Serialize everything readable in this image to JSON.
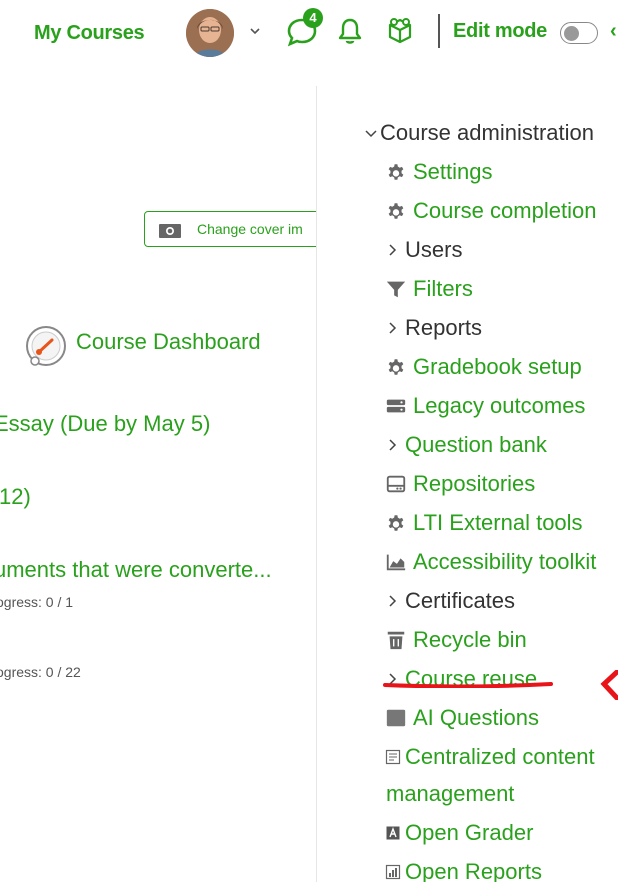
{
  "navbar": {
    "title": "My Courses",
    "messages_count": "4",
    "edit_mode_label": "Edit mode",
    "cut_glyph": "‹"
  },
  "left": {
    "cover_button": "Change cover im",
    "dashboard_link": "Course Dashboard",
    "activities": [
      "Essay (Due by May 5)",
      "12)",
      "uments that were converte..."
    ],
    "progress": [
      "ogress: 0 / 1",
      "ogress: 0 / 22"
    ]
  },
  "admin": {
    "heading": "Course administration",
    "items": [
      {
        "label": "Settings",
        "icon": "gear-icon",
        "kind": "link"
      },
      {
        "label": "Course completion",
        "icon": "gear-icon",
        "kind": "link"
      },
      {
        "label": "Users",
        "icon": "chevron-right-icon",
        "kind": "plain"
      },
      {
        "label": "Filters",
        "icon": "filter-icon",
        "kind": "link"
      },
      {
        "label": "Reports",
        "icon": "chevron-right-icon",
        "kind": "plain"
      },
      {
        "label": "Gradebook setup",
        "icon": "gear-icon",
        "kind": "link"
      },
      {
        "label": "Legacy outcomes",
        "icon": "server-icon",
        "kind": "link"
      },
      {
        "label": "Question bank",
        "icon": "chevron-right-icon",
        "kind": "link"
      },
      {
        "label": "Repositories",
        "icon": "hdd-icon",
        "kind": "link"
      },
      {
        "label": "LTI External tools",
        "icon": "gear-icon",
        "kind": "link"
      },
      {
        "label": "Accessibility toolkit",
        "icon": "area-chart-icon",
        "kind": "link"
      },
      {
        "label": "Certificates",
        "icon": "chevron-right-icon",
        "kind": "plain"
      },
      {
        "label": "Recycle bin",
        "icon": "trash-icon",
        "kind": "link"
      },
      {
        "label": "Course reuse",
        "icon": "chevron-right-icon",
        "kind": "link"
      },
      {
        "label": "AI Questions",
        "icon": "square-icon",
        "kind": "link"
      },
      {
        "label": "Centralized content",
        "icon": "document-icon",
        "kind": "link"
      },
      {
        "label": "management",
        "icon": "",
        "kind": "link"
      },
      {
        "label": "Open Grader",
        "icon": "grader-icon",
        "kind": "link"
      },
      {
        "label": "Open Reports",
        "icon": "bar-chart-icon",
        "kind": "link"
      }
    ]
  },
  "colors": {
    "accent": "#2aa11c",
    "annotation": "#e8141a"
  }
}
